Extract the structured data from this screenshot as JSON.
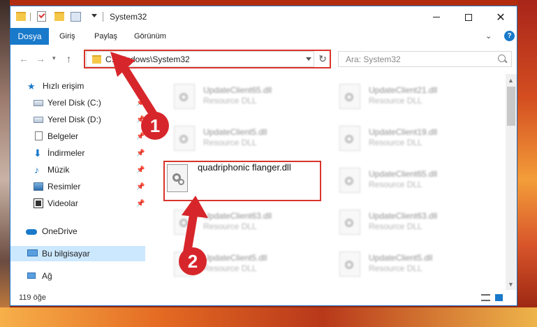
{
  "window": {
    "title": "System32",
    "tabs": {
      "file": "Dosya",
      "home": "Giriş",
      "share": "Paylaş",
      "view": "Görünüm"
    },
    "help_label": "?"
  },
  "navigation": {
    "address": "C:\\Windows\\System32",
    "search_placeholder": "Ara: System32"
  },
  "sidebar": {
    "items": [
      {
        "label": "Hızlı erişim",
        "icon": "star-icon",
        "pinned": false
      },
      {
        "label": "Yerel Disk (C:)",
        "icon": "drive-icon",
        "pinned": true
      },
      {
        "label": "Yerel Disk (D:)",
        "icon": "drive-icon",
        "pinned": true
      },
      {
        "label": "Belgeler",
        "icon": "document-icon",
        "pinned": true
      },
      {
        "label": "İndirmeler",
        "icon": "download-icon",
        "pinned": true
      },
      {
        "label": "Müzik",
        "icon": "music-icon",
        "pinned": true
      },
      {
        "label": "Resimler",
        "icon": "pictures-icon",
        "pinned": true
      },
      {
        "label": "Videolar",
        "icon": "video-icon",
        "pinned": true
      },
      {
        "label": "OneDrive",
        "icon": "cloud-icon",
        "pinned": false
      },
      {
        "label": "Bu bilgisayar",
        "icon": "computer-icon",
        "pinned": false,
        "selected": true
      },
      {
        "label": "Ağ",
        "icon": "network-icon",
        "pinned": false
      }
    ]
  },
  "files": {
    "column_left": [
      {
        "name": "UpdateClient65.dll",
        "type": "Resource DLL"
      },
      {
        "name": "UpdateClient5.dll",
        "type": "Resource DLL"
      },
      {
        "name": "quadriphonic flanger.dll",
        "type": "",
        "highlighted": true
      },
      {
        "name": "UpdateClient63.dll",
        "type": "Resource DLL"
      },
      {
        "name": "UpdateClient5.dll",
        "type": "Resource DLL"
      }
    ],
    "column_right": [
      {
        "name": "UpdateClient21.dll",
        "type": "Resource DLL"
      },
      {
        "name": "UpdateClient19.dll",
        "type": "Resource DLL"
      },
      {
        "name": "UpdateClient65.dll",
        "type": "Resource DLL"
      },
      {
        "name": "UpdateClient63.dll",
        "type": "Resource DLL"
      },
      {
        "name": "UpdateClient5.dll",
        "type": "Resource DLL"
      }
    ]
  },
  "status": {
    "item_count": "119 öğe"
  },
  "annotations": {
    "step1": "1",
    "step2": "2"
  },
  "colors": {
    "accent": "#1979ca",
    "highlight": "#d9342b",
    "badge": "#d7262b"
  }
}
